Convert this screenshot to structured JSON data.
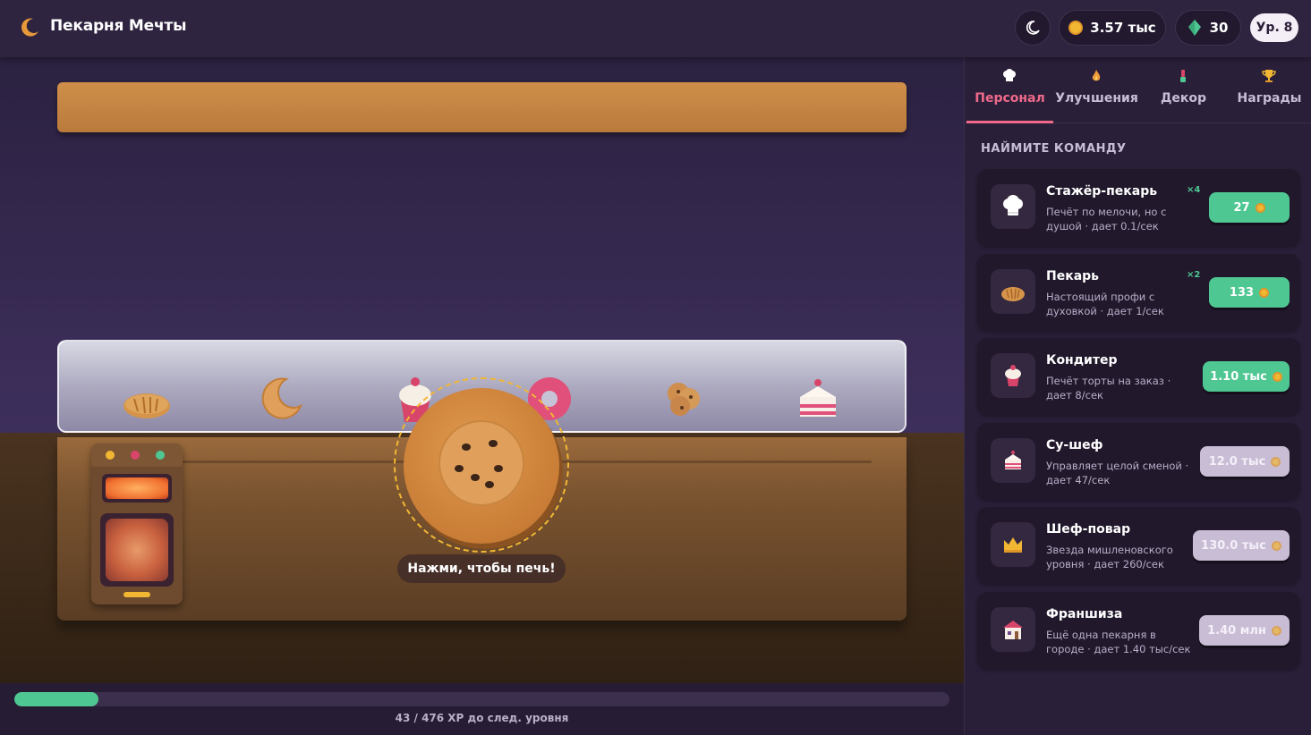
{
  "header": {
    "title": "Пекарня Мечты",
    "coins": "3.57 тыс",
    "gems": "30",
    "level": "Ур. 8"
  },
  "scene": {
    "display_items": [
      "bread-icon",
      "croissant-icon",
      "cupcake-icon",
      "donut-icon",
      "cookie-cluster-icon",
      "cake-slice-icon"
    ],
    "bake_caption": "Нажми, чтобы печь!"
  },
  "xp": {
    "text": "43 / 476 XP до след. уровня",
    "progress": 0.09
  },
  "panel": {
    "tabs": [
      {
        "label": "Персонал",
        "icon": "chef-hat-icon",
        "active": true
      },
      {
        "label": "Улучшения",
        "icon": "flame-icon",
        "active": false
      },
      {
        "label": "Декор",
        "icon": "brush-icon",
        "active": false
      },
      {
        "label": "Награды",
        "icon": "trophy-icon",
        "active": false
      }
    ],
    "section_title": "НАЙМИТЕ КОМАНДУ",
    "staff": [
      {
        "name": "Стажёр-пекарь",
        "desc": "Печёт по мелочи, но с душой · дает 0.1/сек",
        "count": "×4",
        "price": "27",
        "affordable": true,
        "icon": "chef-hat-icon"
      },
      {
        "name": "Пекарь",
        "desc": "Настоящий профи с духовкой · дает 1/сек",
        "count": "×2",
        "price": "133",
        "affordable": true,
        "icon": "bread-icon"
      },
      {
        "name": "Кондитер",
        "desc": "Печёт торты на заказ · дает 8/сек",
        "count": "",
        "price": "1.10 тыс",
        "affordable": true,
        "icon": "cupcake-icon"
      },
      {
        "name": "Су-шеф",
        "desc": "Управляет целой сменой · дает 47/сек",
        "count": "",
        "price": "12.0 тыс",
        "affordable": false,
        "icon": "cake-slice-icon"
      },
      {
        "name": "Шеф-повар",
        "desc": "Звезда мишленовского уровня · дает 260/сек",
        "count": "",
        "price": "130.0 тыс",
        "affordable": false,
        "icon": "crown-icon"
      },
      {
        "name": "Франшиза",
        "desc": "Ещё одна пекарня в городе · дает 1.40 тыс/сек",
        "count": "",
        "price": "1.40 млн",
        "affordable": false,
        "icon": "shop-icon"
      }
    ]
  },
  "colors": {
    "accent_pink": "#ef6a8a",
    "accent_green": "#4fc792",
    "coin_gold": "#f1b733",
    "background": "#2a1f38"
  }
}
